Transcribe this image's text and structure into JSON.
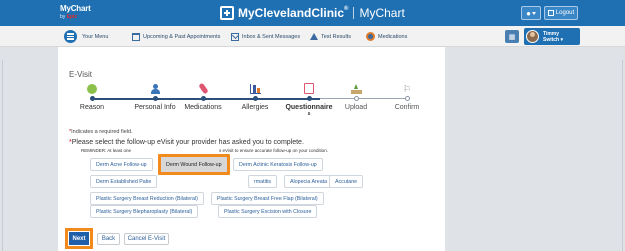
{
  "header": {
    "logo_line1": "MyChart",
    "logo_by": "by",
    "logo_epic": "Epic",
    "brand_name": "MyClevelandClinic",
    "brand_registered": "®",
    "brand_sub": "MyChart",
    "logout_label": "Logout",
    "people_icon": "people-switch-icon"
  },
  "nav": {
    "menu_label": "Your Menu",
    "appointments_label": "Upcoming & Past Appointments",
    "messages_label": "Inbox & Sent Messages",
    "results_label": "Test Results",
    "medications_label": "Medications",
    "switch_name": "Timmy",
    "switch_action": "Switch"
  },
  "page": {
    "title": "E-Visit"
  },
  "steps": [
    {
      "label": "Reason",
      "icon": "reason-icon",
      "state": "done"
    },
    {
      "label": "Personal Info",
      "icon": "person-icon",
      "state": "done"
    },
    {
      "label": "Medications",
      "icon": "pill-icon",
      "state": "done"
    },
    {
      "label": "Allergies",
      "icon": "chart-icon",
      "state": "done"
    },
    {
      "label": "Questionnaire",
      "extra": "s",
      "icon": "clipboard-icon",
      "state": "active"
    },
    {
      "label": "Upload",
      "icon": "upload-icon",
      "state": "future"
    },
    {
      "label": "Confirm",
      "icon": "flag-icon",
      "state": "future"
    }
  ],
  "form": {
    "required_note": "Indicates a required field.",
    "select_prompt": "Please select the follow-up eVisit your provider has asked you to complete.",
    "reminder_prefix": "REMINDER: At least one",
    "reminder_suffix": "s eVisit to ensure accurate follow-up on your condition.",
    "options": [
      {
        "label": "Derm Acne Follow-up",
        "selected": false
      },
      {
        "label": "Derm Wound Follow-up",
        "selected": true
      },
      {
        "label": "Derm Actinic Keratosis Follow-up",
        "selected": false
      },
      {
        "label": "Derm Established Patie",
        "selected": false
      },
      {
        "label": "rmatitis",
        "selected": false
      },
      {
        "label": "rmatitis",
        "selected": false
      },
      {
        "label": "Alopecia Areata",
        "selected": false
      },
      {
        "label": "Accutane",
        "selected": false
      },
      {
        "label": "Plastic Surgery Breast Reduction (Bilateral)",
        "selected": false
      },
      {
        "label": "Plastic Surgery Breast Free Flap (Bilateral)",
        "selected": false
      },
      {
        "label": "Plastic Surgery Blepharoplasty (Bilateral)",
        "selected": false
      },
      {
        "label": "Plastic Surgery Excision with Closure",
        "selected": false
      }
    ]
  },
  "actions": {
    "next": "Next",
    "back": "Back",
    "cancel": "Cancel E-Visit"
  },
  "colors": {
    "header_blue": "#1f70b3",
    "highlight_orange": "#f28a1e",
    "next_blue": "#1f5faa",
    "required_red": "#d0021b"
  }
}
